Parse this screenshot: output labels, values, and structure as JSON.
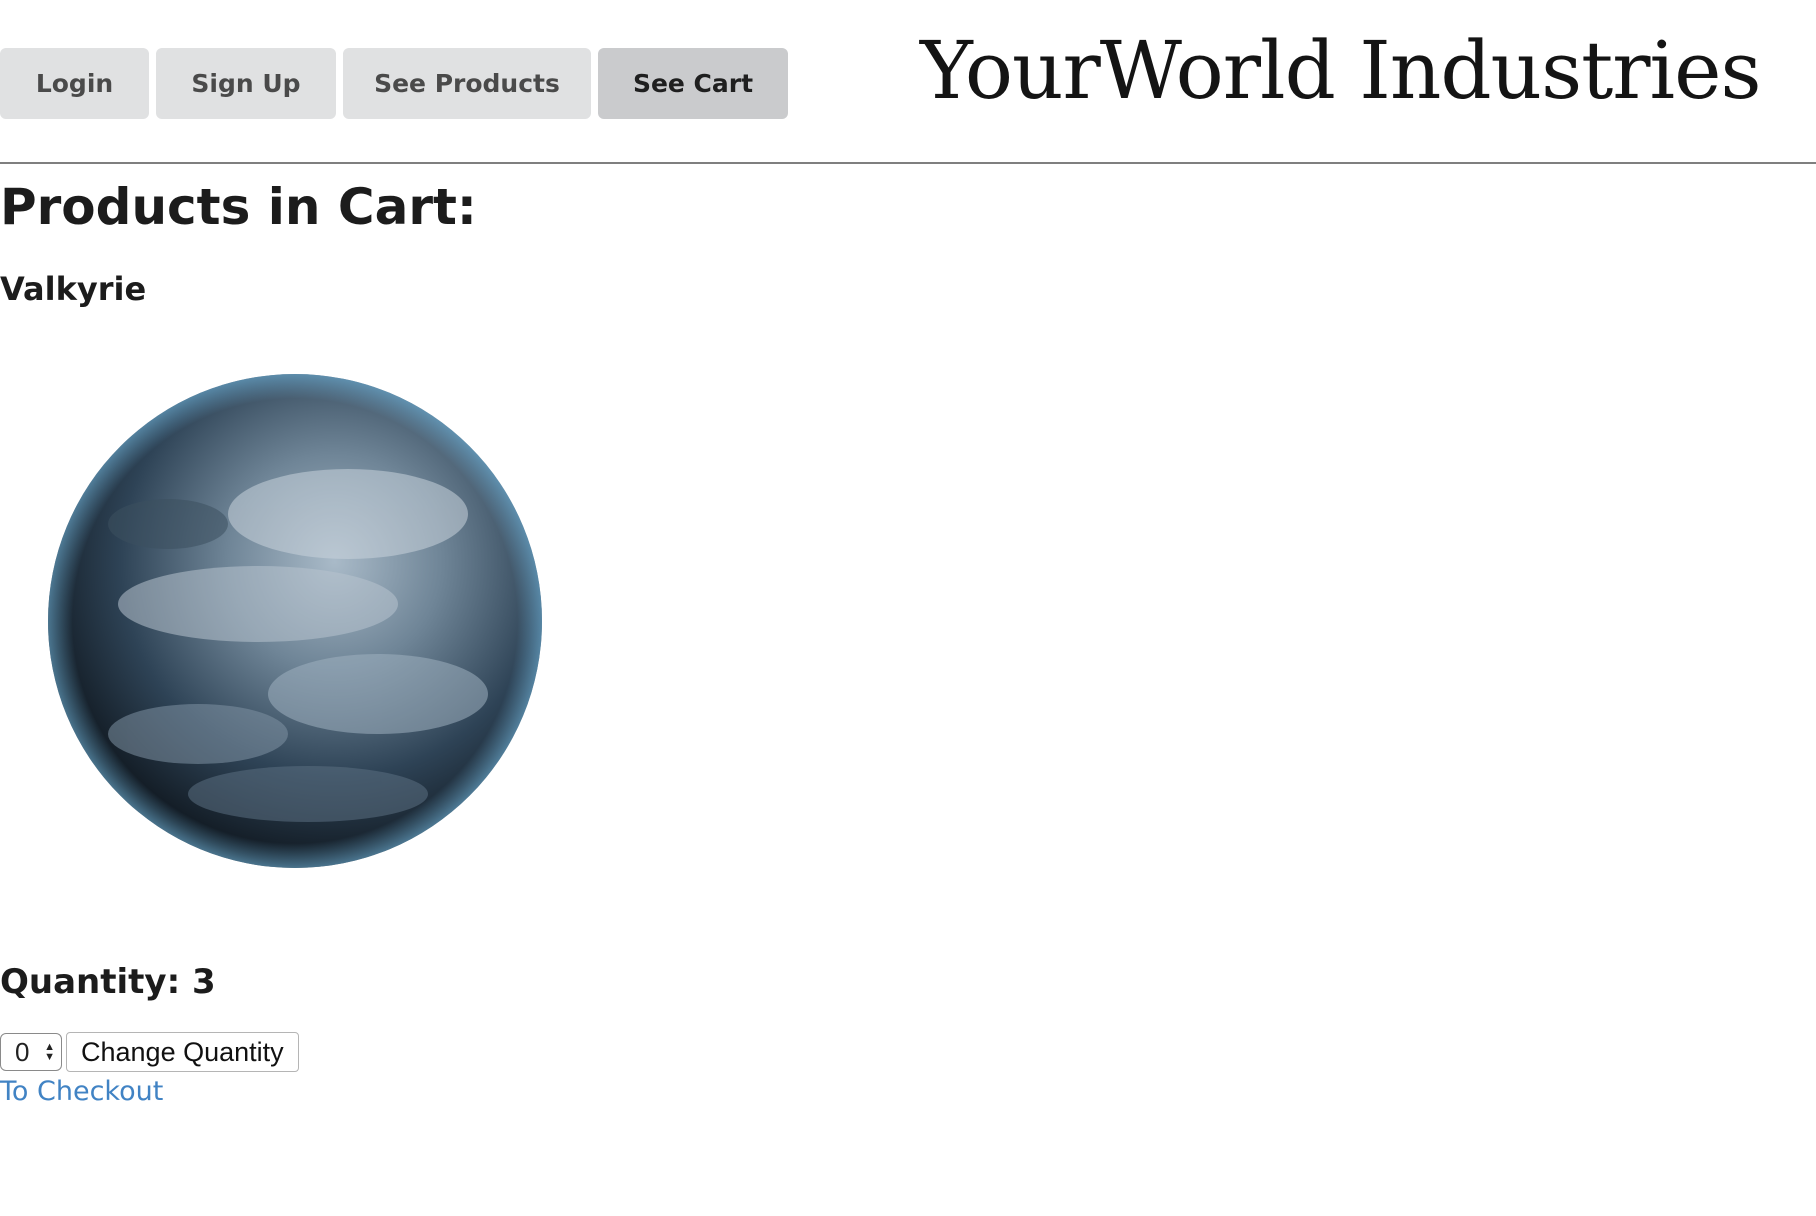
{
  "nav": {
    "login": "Login",
    "signup": "Sign Up",
    "products": "See Products",
    "cart": "See Cart"
  },
  "brand": "YourWorld Industries",
  "cart": {
    "title": "Products in Cart:",
    "item": {
      "name": "Valkyrie",
      "image_icon": "planet-image",
      "quantity_text": "Quantity: 3",
      "stepper_value": "0",
      "change_label": "Change Quantity"
    },
    "checkout_label": "To Checkout"
  },
  "colors": {
    "link": "#4183c4",
    "nav_bg": "#e0e1e2",
    "nav_active_bg": "#cacbcd"
  }
}
